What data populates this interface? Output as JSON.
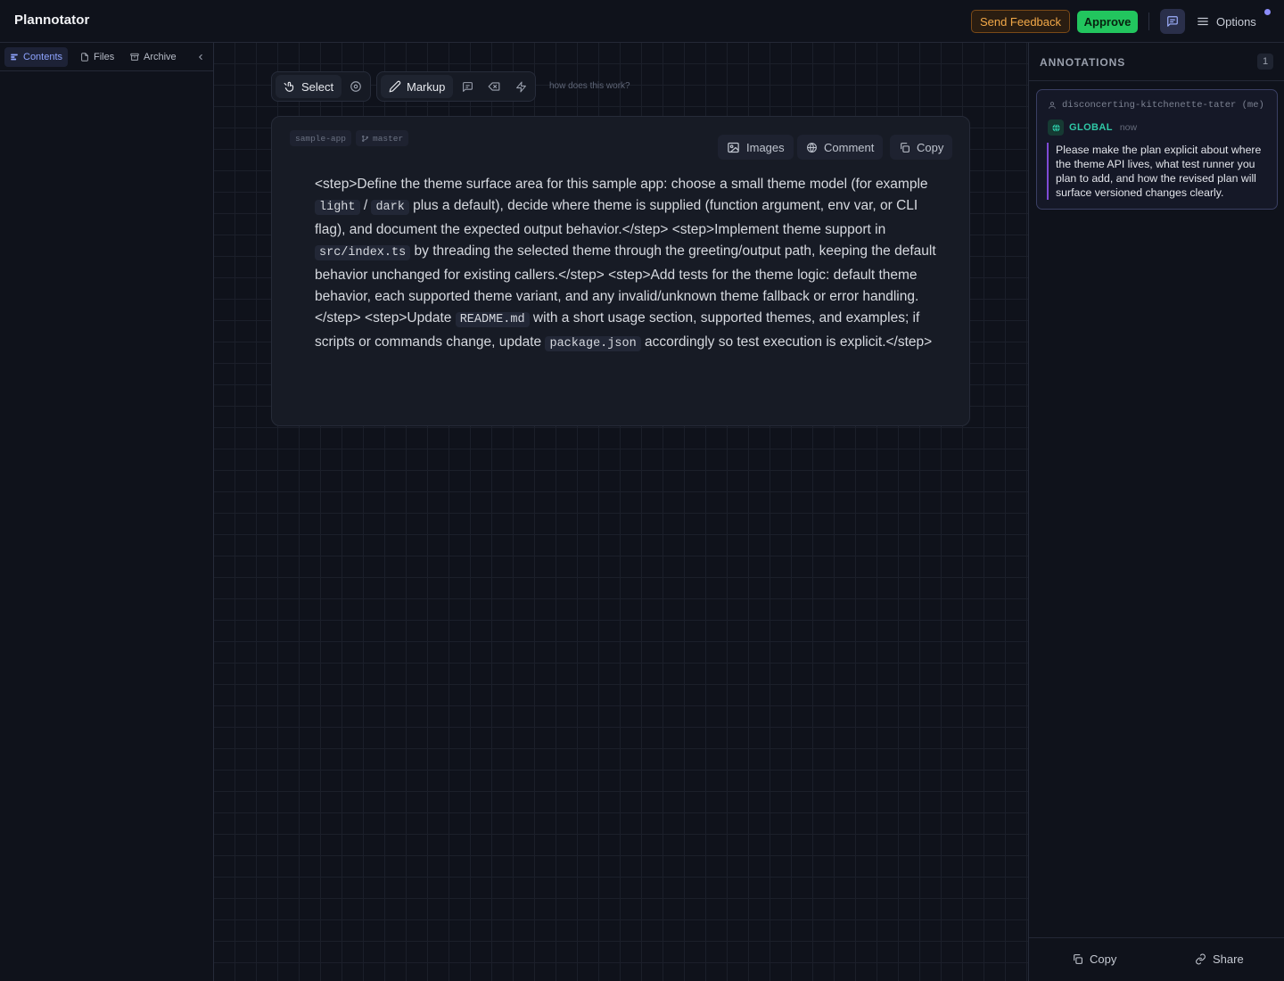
{
  "header": {
    "app_title": "Plannotator",
    "feedback_label": "Send Feedback",
    "approve_label": "Approve",
    "options_label": "Options"
  },
  "sidebar": {
    "tabs": [
      {
        "label": "Contents",
        "icon": "list-icon",
        "active": true
      },
      {
        "label": "Files",
        "icon": "file-icon",
        "active": false
      },
      {
        "label": "Archive",
        "icon": "archive-icon",
        "active": false
      }
    ]
  },
  "toolbar": {
    "select_label": "Select",
    "markup_label": "Markup",
    "help_text": "how does this work?"
  },
  "document": {
    "project_chip": "sample-app",
    "branch_chip": "master",
    "images_label": "Images",
    "comment_label": "Comment",
    "copy_label": "Copy",
    "segments": [
      {
        "t": "<step>Define the theme surface area for this sample app: choose a small theme model (for example "
      },
      {
        "c": "light"
      },
      {
        "t": " / "
      },
      {
        "c": "dark"
      },
      {
        "t": " plus a default), decide where theme is supplied (function argument, env var, or CLI flag), and document the expected output behavior.</step> <step>Implement theme support in "
      },
      {
        "c": "src/index.ts"
      },
      {
        "t": " by threading the selected theme through the greeting/output path, keeping the default behavior unchanged for existing callers.</step> <step>Add tests for the theme logic: default theme behavior, each supported theme variant, and any invalid/unknown theme fallback or error handling.</step> <step>Update "
      },
      {
        "c": "README.md"
      },
      {
        "t": " with a short usage section, supported themes, and examples; if scripts or commands change, update "
      },
      {
        "c": "package.json"
      },
      {
        "t": " accordingly so test execution is explicit.</step>"
      }
    ]
  },
  "annotations": {
    "title": "ANNOTATIONS",
    "count": "1",
    "items": [
      {
        "author": "disconcerting-kitchenette-tater (me)",
        "scope": "GLOBAL",
        "time": "now",
        "text": "Please make the plan explicit about where the theme API lives, what test runner you plan to add, and how the revised plan will surface versioned changes clearly."
      }
    ],
    "footer_copy": "Copy",
    "footer_share": "Share"
  },
  "colors": {
    "background": "#0e111a",
    "accent": "#8ea4ff",
    "approve": "#22c55e",
    "feedback": "#f3a948",
    "global_scope": "#2fc8a6",
    "annotation_bar": "#7e4ad6"
  }
}
